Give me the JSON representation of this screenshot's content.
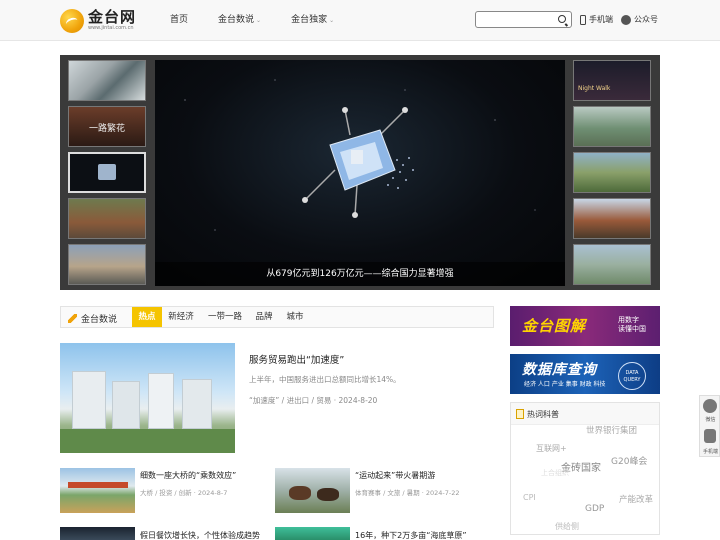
{
  "header": {
    "logo_text": "金台网",
    "logo_url": "www.jintai.com.cn",
    "nav": [
      {
        "label": "首页",
        "dropdown": false
      },
      {
        "label": "金台数说",
        "dropdown": true
      },
      {
        "label": "金台独家",
        "dropdown": true
      }
    ],
    "search": {
      "placeholder": "",
      "icon": "search-icon"
    },
    "mobile_label": "手机端",
    "wechat_label": "公众号"
  },
  "banner": {
    "caption": "从679亿元到126万亿元——综合国力显著增强",
    "left_thumbs": [
      {
        "text": ""
      },
      {
        "text": "一路繁花"
      },
      {
        "text": ""
      },
      {
        "text": ""
      },
      {
        "text": ""
      }
    ],
    "right_thumbs": [
      {
        "text": "Night Walk"
      },
      {
        "text": ""
      },
      {
        "text": ""
      },
      {
        "text": ""
      },
      {
        "text": ""
      }
    ]
  },
  "section": {
    "title": "金台数说",
    "tabs": [
      "热点",
      "新经济",
      "一带一路",
      "品牌",
      "城市"
    ],
    "active_tab": "热点"
  },
  "featured": {
    "title": "服务贸易跑出“加速度”",
    "summary": "上半年，中国服务进出口总额同比增长14%。",
    "tags": "“加速度” / 进出口 / 贸易 · 2024-8-20"
  },
  "news": [
    {
      "title": "细数一座大桥的“乘数效应”",
      "tags": "大桥 / 投资 / 创新 · 2024-8-7"
    },
    {
      "title": "“运动起来”带火暑期游",
      "tags": "体育赛事 / 文旅 / 暑期 · 2024-7-22"
    },
    {
      "title": "假日餐饮增长快，个性体验成趋势",
      "tags": ""
    },
    {
      "title": "16年，种下2万多亩“海底草原”",
      "tags": ""
    }
  ],
  "ads": {
    "ad1": {
      "main": "金台图解",
      "sub1": "用数字",
      "sub2": "读懂中国"
    },
    "ad2": {
      "main": "数据库查询",
      "sub": "经济 人口 产业 集事 财政 科技",
      "badge1": "DATA",
      "badge2": "QUERY"
    }
  },
  "hot_words": {
    "title": "热词科普",
    "words": [
      "世界银行集团",
      "互联网+",
      "金砖国家",
      "G20峰会",
      "CPI",
      "GDP",
      "产能改革",
      "供给侧",
      "上合组织"
    ]
  },
  "float_bar": {
    "wechat_label": "微信",
    "mobile_label": "手机端"
  },
  "colors": {
    "accent_yellow": "#f5c400",
    "ad1_bg": "#6b2277",
    "ad2_bg": "#1653a3"
  }
}
